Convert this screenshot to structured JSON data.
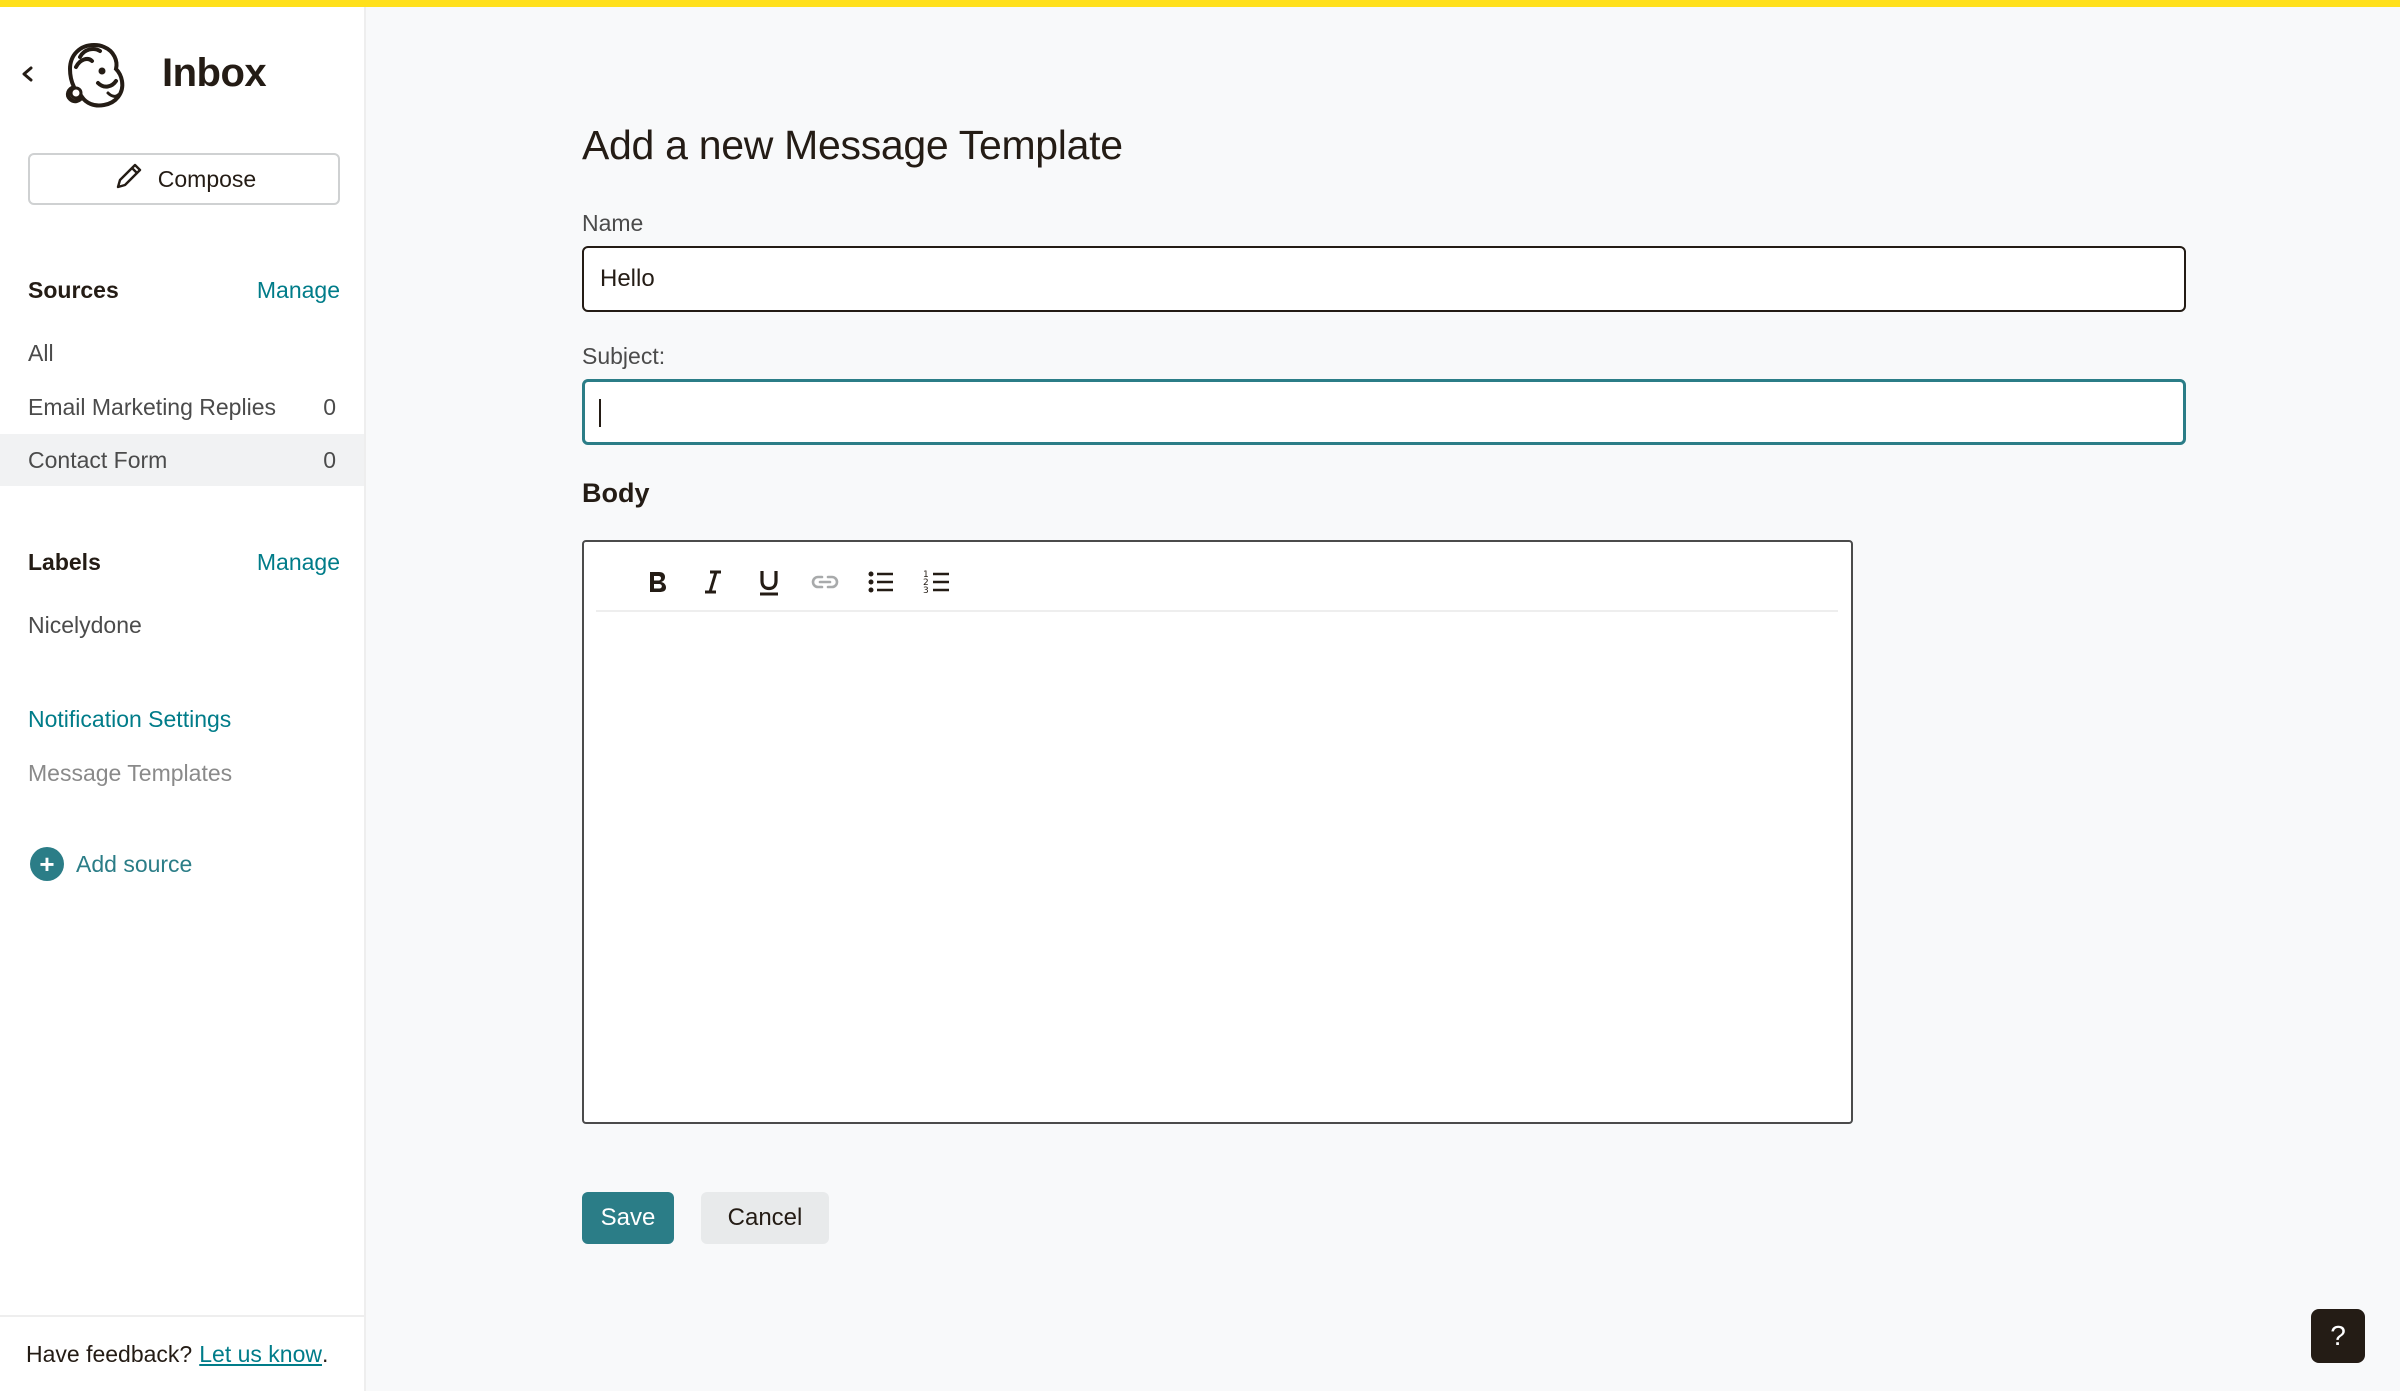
{
  "app": {
    "title": "Inbox"
  },
  "sidebar": {
    "compose_label": "Compose",
    "sources": {
      "title": "Sources",
      "manage_label": "Manage",
      "items": [
        {
          "label": "All",
          "count": ""
        },
        {
          "label": "Email Marketing Replies",
          "count": "0"
        },
        {
          "label": "Contact Form",
          "count": "0",
          "active": true
        }
      ]
    },
    "labels": {
      "title": "Labels",
      "manage_label": "Manage",
      "items": [
        {
          "label": "Nicelydone"
        }
      ]
    },
    "notification_settings": "Notification Settings",
    "message_templates": "Message Templates",
    "add_source": "Add source",
    "feedback": {
      "text": "Have feedback?",
      "link": "Let us know",
      "suffix": "."
    }
  },
  "form": {
    "title": "Add a new Message Template",
    "name_label": "Name",
    "name_value": "Hello",
    "subject_label": "Subject:",
    "subject_value": "",
    "body_label": "Body",
    "save_label": "Save",
    "cancel_label": "Cancel"
  },
  "help_label": "?",
  "colors": {
    "accent": "#2b7d87",
    "topbar": "#ffe01b",
    "text": "#241c15"
  }
}
